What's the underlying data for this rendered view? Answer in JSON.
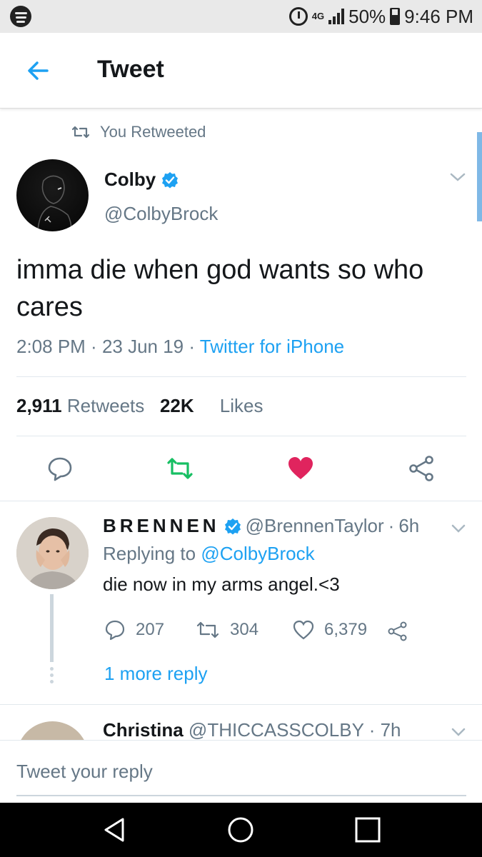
{
  "status_bar": {
    "network": "4G",
    "battery": "50%",
    "time": "9:46 PM"
  },
  "header": {
    "title": "Tweet"
  },
  "retweet_label": "You Retweeted",
  "tweet": {
    "author_name": "Colby",
    "author_handle": "@ColbyBrock",
    "text": "imma die when god wants so who cares",
    "time": "2:08 PM",
    "date": "23 Jun 19",
    "source": "Twitter for iPhone",
    "retweets_count": "2,911",
    "retweets_label": "Retweets",
    "likes_count": "22K",
    "likes_label": "Likes",
    "colors": {
      "retweet": "#17bf63",
      "like": "#e0245e",
      "link": "#1da1f2"
    }
  },
  "reply": {
    "author_name": "BRENNEN",
    "author_handle": "@BrennenTaylor",
    "age": "6h",
    "replying_to_label": "Replying to",
    "replying_to_handle": "@ColbyBrock",
    "text": "die now in my arms angel.<3",
    "reply_count": "207",
    "retweet_count": "304",
    "like_count": "6,379",
    "more_replies": "1 more reply"
  },
  "next_reply": {
    "author_name": "Christina",
    "author_handle": "@THICCASSCOLBY",
    "age": "7h"
  },
  "composer": {
    "placeholder": "Tweet your reply"
  }
}
